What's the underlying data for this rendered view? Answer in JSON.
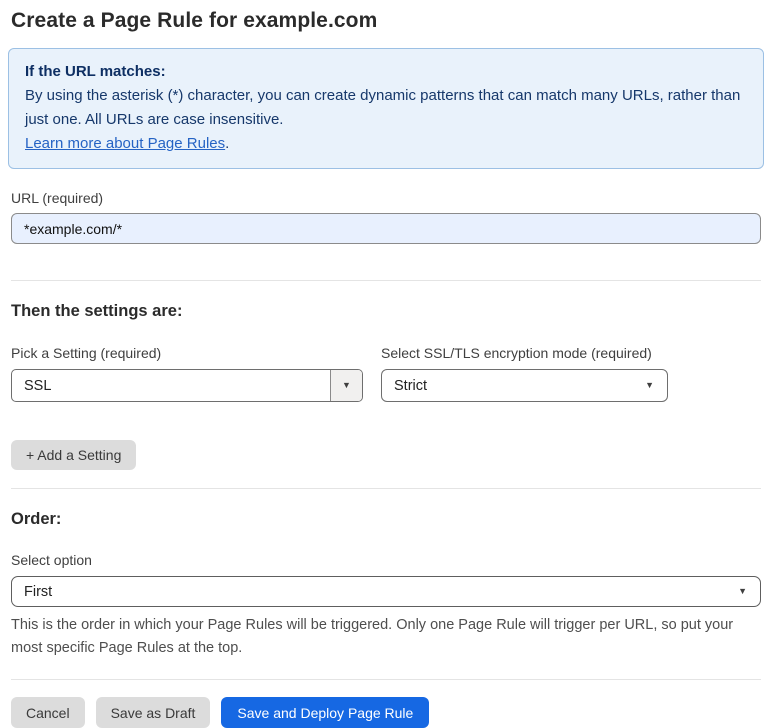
{
  "page": {
    "title": "Create a Page Rule for example.com"
  },
  "info_box": {
    "heading": "If the URL matches:",
    "body": "By using the asterisk (*) character, you can create dynamic patterns that can match many URLs, rather than just one. All URLs are case insensitive.",
    "link_label": "Learn more about Page Rules",
    "link_suffix": "."
  },
  "url_field": {
    "label": "URL (required)",
    "value": "*example.com/*"
  },
  "settings_section": {
    "heading": "Then the settings are:",
    "setting_select": {
      "label": "Pick a Setting (required)",
      "value": "SSL"
    },
    "mode_select": {
      "label": "Select SSL/TLS encryption mode (required)",
      "value": "Strict"
    },
    "add_setting_label": "+ Add a Setting"
  },
  "order_section": {
    "heading": "Order:",
    "select_label": "Select option",
    "select_value": "First",
    "help_text": "This is the order in which your Page Rules will be triggered. Only one Page Rule will trigger per URL, so put your most specific Page Rules at the top."
  },
  "footer": {
    "cancel_label": "Cancel",
    "save_draft_label": "Save as Draft",
    "save_deploy_label": "Save and Deploy Page Rule"
  },
  "icons": {
    "caret_down": "▼"
  },
  "colors": {
    "primary_button": "#1668e3",
    "info_background": "#e9f2fb",
    "info_border": "#9cc0e4",
    "info_text": "#16386b",
    "link": "#2563c4",
    "autofill_input_background": "#e8f0fe",
    "gray_button": "#dcdcdc"
  }
}
